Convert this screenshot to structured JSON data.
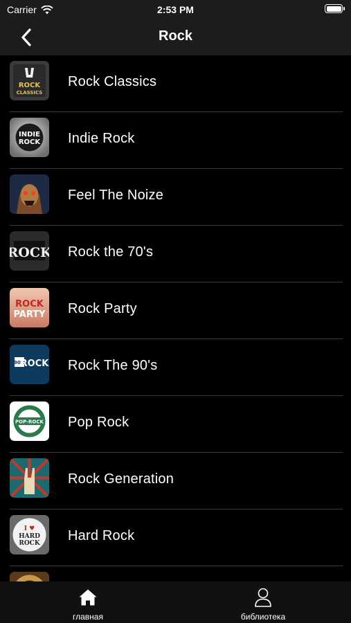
{
  "status_bar": {
    "carrier": "Carrier",
    "time": "2:53 PM"
  },
  "nav": {
    "title": "Rock"
  },
  "stations": [
    {
      "name": "Rock Classics",
      "art": "rock-classics-art",
      "art_text": [
        "ROCK",
        "CLASSICS"
      ]
    },
    {
      "name": "Indie Rock",
      "art": "indie-rock-art",
      "art_text": [
        "INDIE",
        "ROCK"
      ]
    },
    {
      "name": "Feel The Noize",
      "art": "feel-the-noize-art",
      "art_text": []
    },
    {
      "name": "Rock the 70's",
      "art": "rock-70s-art",
      "art_text": [
        "ROCK"
      ]
    },
    {
      "name": "Rock Party",
      "art": "rock-party-art",
      "art_text": [
        "ROCK",
        "PARTY"
      ]
    },
    {
      "name": "Rock The 90's",
      "art": "rock-90s-art",
      "art_text": [
        "90's",
        "ROCK"
      ]
    },
    {
      "name": "Pop Rock",
      "art": "pop-rock-art",
      "art_text": [
        "POP-ROCK"
      ]
    },
    {
      "name": "Rock Generation",
      "art": "rock-generation-art",
      "art_text": []
    },
    {
      "name": "Hard Rock",
      "art": "hard-rock-art",
      "art_text": [
        "I ♥",
        "HARD",
        "ROCK"
      ]
    },
    {
      "name": "",
      "art": "partial-art",
      "art_text": []
    }
  ],
  "tabs": {
    "home": "главная",
    "library": "библиотека"
  },
  "colors": {
    "nav_bg": "#1c1c1c",
    "background": "#000000",
    "separator": "#3a3a3a",
    "tabbar_bg": "#111111"
  }
}
